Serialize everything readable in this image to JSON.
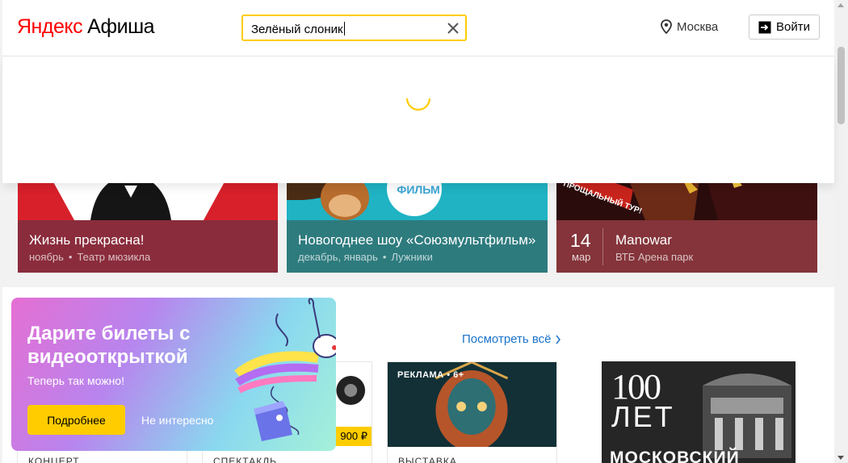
{
  "header": {
    "logo_brand": "Яндекс",
    "logo_service": "Афиша",
    "search": {
      "value": "Зелёный слоник"
    },
    "city": "Москва",
    "login_label": "Войти"
  },
  "top_events": [
    {
      "title": "Жизнь прекрасна!",
      "when": "ноябрь",
      "place": "Театр мюзикла"
    },
    {
      "title": "Новогоднее шоу «Союзмультфильм»",
      "when": "декабрь, январь",
      "place": "Лужники",
      "image_text": "ФИЛЬМ"
    },
    {
      "title": "Manowar",
      "day": "14",
      "month": "мар",
      "place": "ВТБ Арена парк",
      "image_text": "ПРОЩАЛЬНЫЙ ТУР!"
    }
  ],
  "section": {
    "see_all": "Посмотреть всё",
    "events": [
      {
        "kind": "КОНЦЕРТ"
      },
      {
        "kind": "СПЕКТАКЛЬ",
        "price": "900 ₽"
      },
      {
        "kind": "ВЫСТАВКА",
        "ad_label": "РЕКЛАМА • 6+"
      },
      {
        "hundred": "100",
        "years": "ЛЕТ",
        "moscow": "МОСКОВСКИЙ"
      }
    ]
  },
  "promo": {
    "title": "Дарите билеты с видеооткрыткой",
    "subtitle": "Теперь так можно!",
    "more_label": "Подробнее",
    "dismiss_label": "Не интересно"
  },
  "colors": {
    "accent": "#ffcc00",
    "link": "#1a73c9",
    "brand_red": "#ff0000"
  }
}
